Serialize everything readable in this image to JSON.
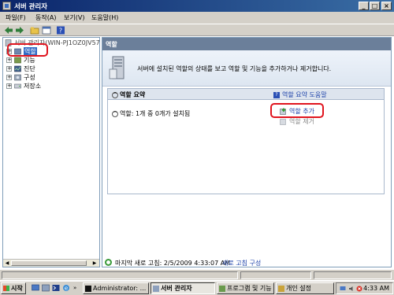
{
  "window": {
    "title": "서버 관리자",
    "controls": {
      "minimize": "_",
      "maximize": "□",
      "close": "×"
    }
  },
  "menu": {
    "items": [
      "파일(F)",
      "동작(A)",
      "보기(V)",
      "도움말(H)"
    ]
  },
  "toolbar": {
    "icons": [
      "back-arrow-icon",
      "forward-arrow-icon",
      "folder-up-icon",
      "properties-icon",
      "help-icon"
    ]
  },
  "tree": {
    "root": "서버 관리자(WIN-PJ1OZ0JV57",
    "items": [
      {
        "label": "역할",
        "icon": "roles-icon",
        "selected": true
      },
      {
        "label": "기능",
        "icon": "features-icon"
      },
      {
        "label": "진단",
        "icon": "diagnostics-icon"
      },
      {
        "label": "구성",
        "icon": "configuration-icon"
      },
      {
        "label": "저장소",
        "icon": "storage-icon"
      }
    ]
  },
  "main": {
    "header": "역할",
    "banner_text": "서버에 설치된 역할의 상태를 보고 역할 및 기능을 추가하거나 제거합니다.",
    "summary": {
      "title": "역할 요약",
      "help_link": "역할 요약 도움말",
      "status_label": "역할:",
      "status_value": "1개 중 0개가 설치됨",
      "actions": {
        "add": "역할 추가",
        "remove": "역할 제거"
      }
    },
    "footer": {
      "last_refresh": "마지막 새로 고침: 2/5/2009 4:33:07 AM",
      "configure_refresh": "새로 고침 구성"
    }
  },
  "taskbar": {
    "start": "시작",
    "tasks": [
      {
        "label": "Administrator: ...",
        "icon": "cmd-icon",
        "active": false
      },
      {
        "label": "서버 관리자",
        "icon": "server-manager-icon",
        "active": true
      },
      {
        "label": "프로그램 및 기능",
        "icon": "programs-icon",
        "active": false
      },
      {
        "label": "개인 설정",
        "icon": "personalize-icon",
        "active": false
      }
    ],
    "clock": "4:33 AM"
  },
  "colors": {
    "title_gradient_start": "#0a246a",
    "title_gradient_end": "#3a6ea5",
    "pane_header": "#6b7f9a",
    "link": "#1a3fa8",
    "annotation_ring": "#e0141e"
  }
}
